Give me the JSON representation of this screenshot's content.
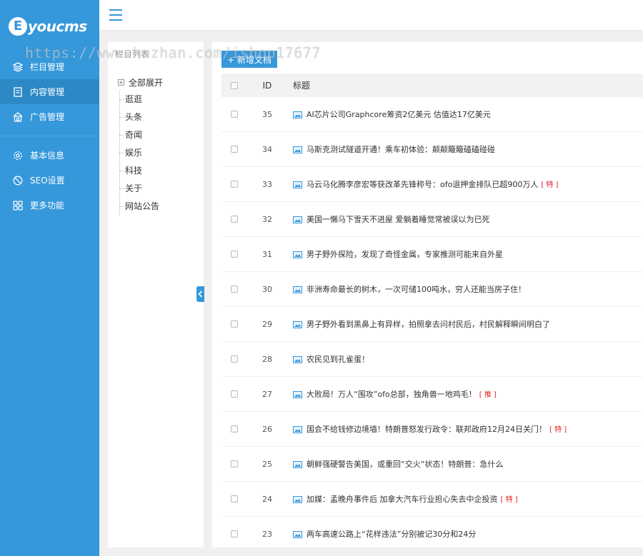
{
  "app": {
    "logo_letter": "E",
    "logo_text": "youcms"
  },
  "sidebar": {
    "items_top": [
      {
        "label": "栏目管理",
        "icon": "layers-icon"
      },
      {
        "label": "内容管理",
        "icon": "document-icon",
        "active": true
      },
      {
        "label": "广告管理",
        "icon": "ad-icon"
      }
    ],
    "items_bottom": [
      {
        "label": "基本信息",
        "icon": "gear-icon"
      },
      {
        "label": "SEO设置",
        "icon": "seo-icon"
      },
      {
        "label": "更多功能",
        "icon": "grid-icon"
      }
    ]
  },
  "tree": {
    "title": "栏目列表",
    "root_label": "全部展开",
    "children": [
      "逛逛",
      "头条",
      "奇闻",
      "娱乐",
      "科技",
      "关于",
      "网站公告"
    ]
  },
  "main": {
    "add_button": "+ 新增文档",
    "columns": {
      "id": "ID",
      "title": "标题"
    },
    "rows": [
      {
        "id": "35",
        "title": "AI芯片公司Graphcore筹资2亿美元 估值达17亿美元",
        "tag": ""
      },
      {
        "id": "34",
        "title": "马斯克测试隧道开通！乘车初体验：颠颠簸簸磕磕碰碰",
        "tag": ""
      },
      {
        "id": "33",
        "title": "马云马化腾李彦宏等获改革先锋称号：ofo退押金排队已超900万人",
        "tag": "[ 特 ]"
      },
      {
        "id": "32",
        "title": "美国一懒马下雪天不进屋 爱躺着睡觉常被误以为已死",
        "tag": ""
      },
      {
        "id": "31",
        "title": "男子野外探险，发现了奇怪金属，专家推测可能来自外星",
        "tag": ""
      },
      {
        "id": "30",
        "title": "非洲寿命最长的树木，一次可储100吨水，穷人还能当房子住！",
        "tag": ""
      },
      {
        "id": "29",
        "title": "男子野外看到黑鼻上有异样，拍照拿去问村民后，村民解释瞬间明白了",
        "tag": ""
      },
      {
        "id": "28",
        "title": "农民见到孔雀蛋！",
        "tag": ""
      },
      {
        "id": "27",
        "title": "大败局！万人“围攻”ofo总部，独角兽一地鸡毛！",
        "tag": "[ 推 ]"
      },
      {
        "id": "26",
        "title": "国会不给钱修边境墙！特朗普怒发行政令：联邦政府12月24日关门！",
        "tag": "[ 特 ]"
      },
      {
        "id": "25",
        "title": "朝鲜强硬警告美国，或重回“交火”状态！特朗普：急什么",
        "tag": ""
      },
      {
        "id": "24",
        "title": "加媒：孟晚舟事件后 加拿大汽车行业担心失去中企投资",
        "tag": "[ 特 ]"
      },
      {
        "id": "23",
        "title": "两车高速公路上“花样违法”分别被记30分和24分",
        "tag": ""
      }
    ]
  },
  "watermark": "https://www.huzhan.com/ishop17677",
  "colors": {
    "primary": "#3598db",
    "active": "#2d89c6",
    "tag": "#e02020"
  }
}
